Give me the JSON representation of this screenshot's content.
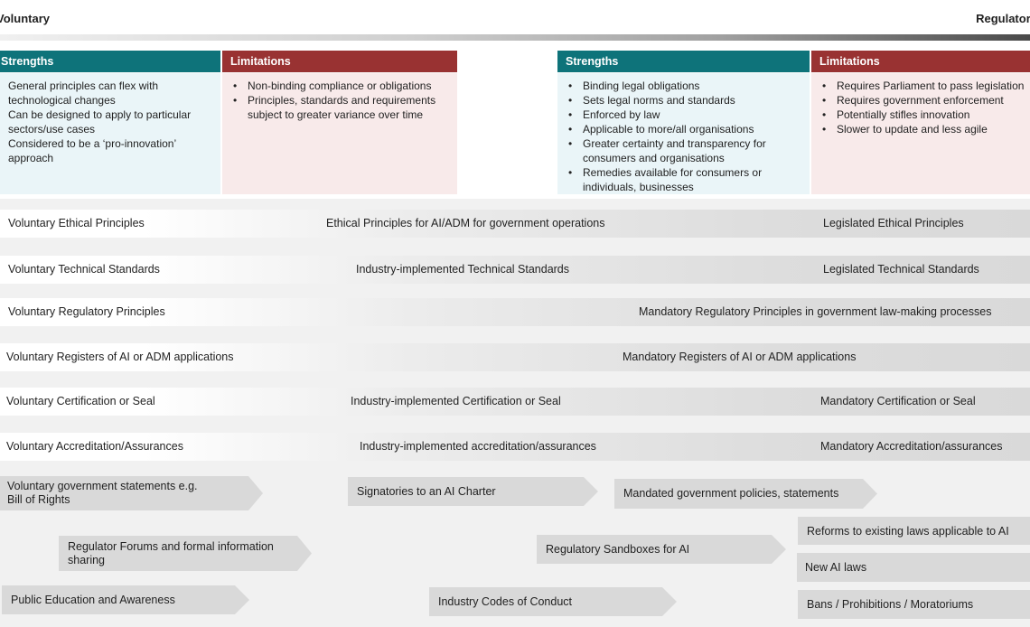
{
  "axis": {
    "left_label": "Voluntary",
    "right_label": "Regulatory"
  },
  "voluntary_panel": {
    "strengths": {
      "title": "Strengths",
      "items": [
        "General principles can flex with technological changes",
        "Can be designed to apply to particular sectors/use cases",
        "Considered to be a ‘pro-innovation’ approach"
      ]
    },
    "limitations": {
      "title": "Limitations",
      "items": [
        "Non-binding compliance or obligations",
        "Principles, standards and requirements subject to greater variance over time"
      ]
    }
  },
  "regulatory_panel": {
    "strengths": {
      "title": "Strengths",
      "items": [
        "Binding legal obligations",
        "Sets legal norms and standards",
        "Enforced by law",
        "Applicable to more/all organisations",
        "Greater certainty and transparency for consumers and organisations",
        "Remedies available for consumers or individuals, businesses"
      ]
    },
    "limitations": {
      "title": "Limitations",
      "items": [
        "Requires Parliament to pass legislation",
        "Requires government enforcement",
        "Potentially stifles innovation",
        "Slower to update and less agile"
      ]
    }
  },
  "rows": [
    {
      "left": "Voluntary Ethical Principles",
      "middle": "Ethical Principles for AI/ADM for government operations",
      "right": "Legislated Ethical Principles"
    },
    {
      "left": "Voluntary Technical Standards",
      "middle": "Industry-implemented Technical Standards",
      "right": "Legislated Technical Standards"
    },
    {
      "left": "Voluntary Regulatory Principles",
      "middle": "",
      "right": "Mandatory Regulatory Principles in government law-making processes"
    },
    {
      "left": "Voluntary Registers of AI or ADM applications",
      "middle": "Mandatory Registers of AI or ADM applications",
      "right": ""
    },
    {
      "left": "Voluntary Certification or Seal",
      "middle": "Industry-implemented  Certification or Seal",
      "right": "Mandatory Certification or Seal"
    },
    {
      "left": "Voluntary Accreditation/Assurances",
      "middle": "Industry-implemented  accreditation/assurances",
      "right": "Mandatory Accreditation/assurances"
    }
  ],
  "mechanisms": {
    "gov_statements": "Voluntary government statements e.g. Bill of Rights",
    "ai_charter": "Signatories to an AI Charter",
    "mandated_policies": "Mandated government policies, statements",
    "regulator_forums": "Regulator Forums and formal information sharing",
    "sandboxes": "Regulatory Sandboxes for AI",
    "reforms": "Reforms to existing laws applicable to AI",
    "new_laws": "New AI laws",
    "public_education": "Public Education and Awareness",
    "codes_of_conduct": "Industry Codes of Conduct",
    "bans": "Bans / Prohibitions / Moratoriums"
  },
  "colors": {
    "strengths_header": "#0e737a",
    "limitations_header": "#993232",
    "strengths_body": "#eaf5f8",
    "limitations_body": "#f8eaea",
    "mechanism_fill": "#d9d9d9",
    "background_lower": "#f1f1f1"
  }
}
